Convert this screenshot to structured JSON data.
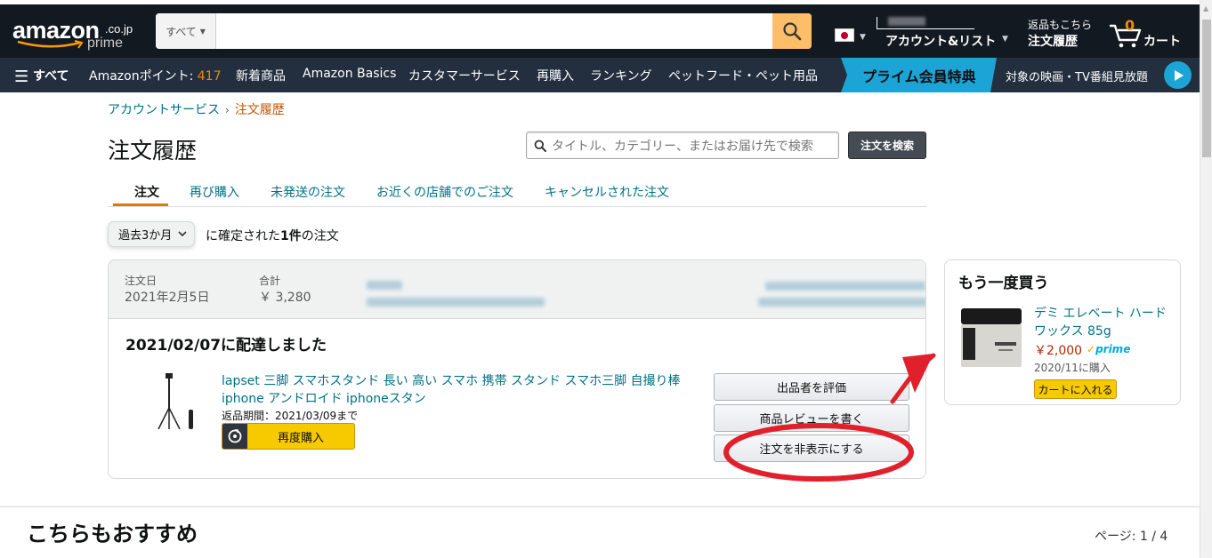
{
  "nav": {
    "logo_word": "amazon",
    "logo_domain": ".co.jp",
    "logo_prime": "prime",
    "search_category": "すべて",
    "search_placeholder": "",
    "account_main": "アカウント&リスト",
    "returns_line1": "返品もこちら",
    "returns_line2": "注文履歴",
    "cart_count": "0",
    "cart_label": "カート"
  },
  "subnav": {
    "all": "すべて",
    "points_label": "Amazonポイント: ",
    "points_value": "417",
    "items": [
      "新着商品",
      "Amazon Basics",
      "カスタマーサービス",
      "再購入",
      "ランキング",
      "ペットフード・ペット用品"
    ],
    "prime_banner": "プライム会員特典",
    "promo": "対象の映画・TV番組見放題"
  },
  "breadcrumb": {
    "parent": "アカウントサービス",
    "separator": "›",
    "current": "注文履歴"
  },
  "page_title": "注文履歴",
  "order_search": {
    "placeholder": "タイトル、カテゴリー、またはお届け先で検索",
    "button": "注文を検索"
  },
  "tabs": [
    "注文",
    "再び購入",
    "未発送の注文",
    "お近くの店舗でのご注文",
    "キャンセルされた注文"
  ],
  "filter": {
    "period": "過去3か月",
    "count_prefix": "に確定された",
    "count_bold": "1件",
    "count_suffix": "の注文"
  },
  "order": {
    "date_label": "注文日",
    "date_value": "2021年2月5日",
    "total_label": "合計",
    "total_value": "￥ 3,280",
    "delivery_status": "2021/02/07に配達しました",
    "product_title": "lapset 三脚 スマホスタンド 長い 高い スマホ 携帯 スタンド スマホ三脚 自撮り棒 iphone アンドロイド iphoneスタン",
    "return_window": "返品期間：2021/03/09まで",
    "rebuy_button": "再度購入",
    "actions": [
      "出品者を評価",
      "商品レビューを書く",
      "注文を非表示にする"
    ]
  },
  "buy_again": {
    "heading": "もう一度買う",
    "title": "デミ エレベート ハードワックス 85g",
    "price": "￥2,000",
    "prime": "prime",
    "date": "2020/11に購入",
    "cart_button": "カートに入れる"
  },
  "recommend": {
    "heading": "こちらもおすすめ",
    "page": "ページ: 1 / 4"
  },
  "colors": {
    "nav_bg": "#131921",
    "subnav_bg": "#232f3e",
    "link": "#007185",
    "accent_orange": "#f08804",
    "button_yellow": "#f7ca00",
    "annotation_red": "#e0202a"
  }
}
